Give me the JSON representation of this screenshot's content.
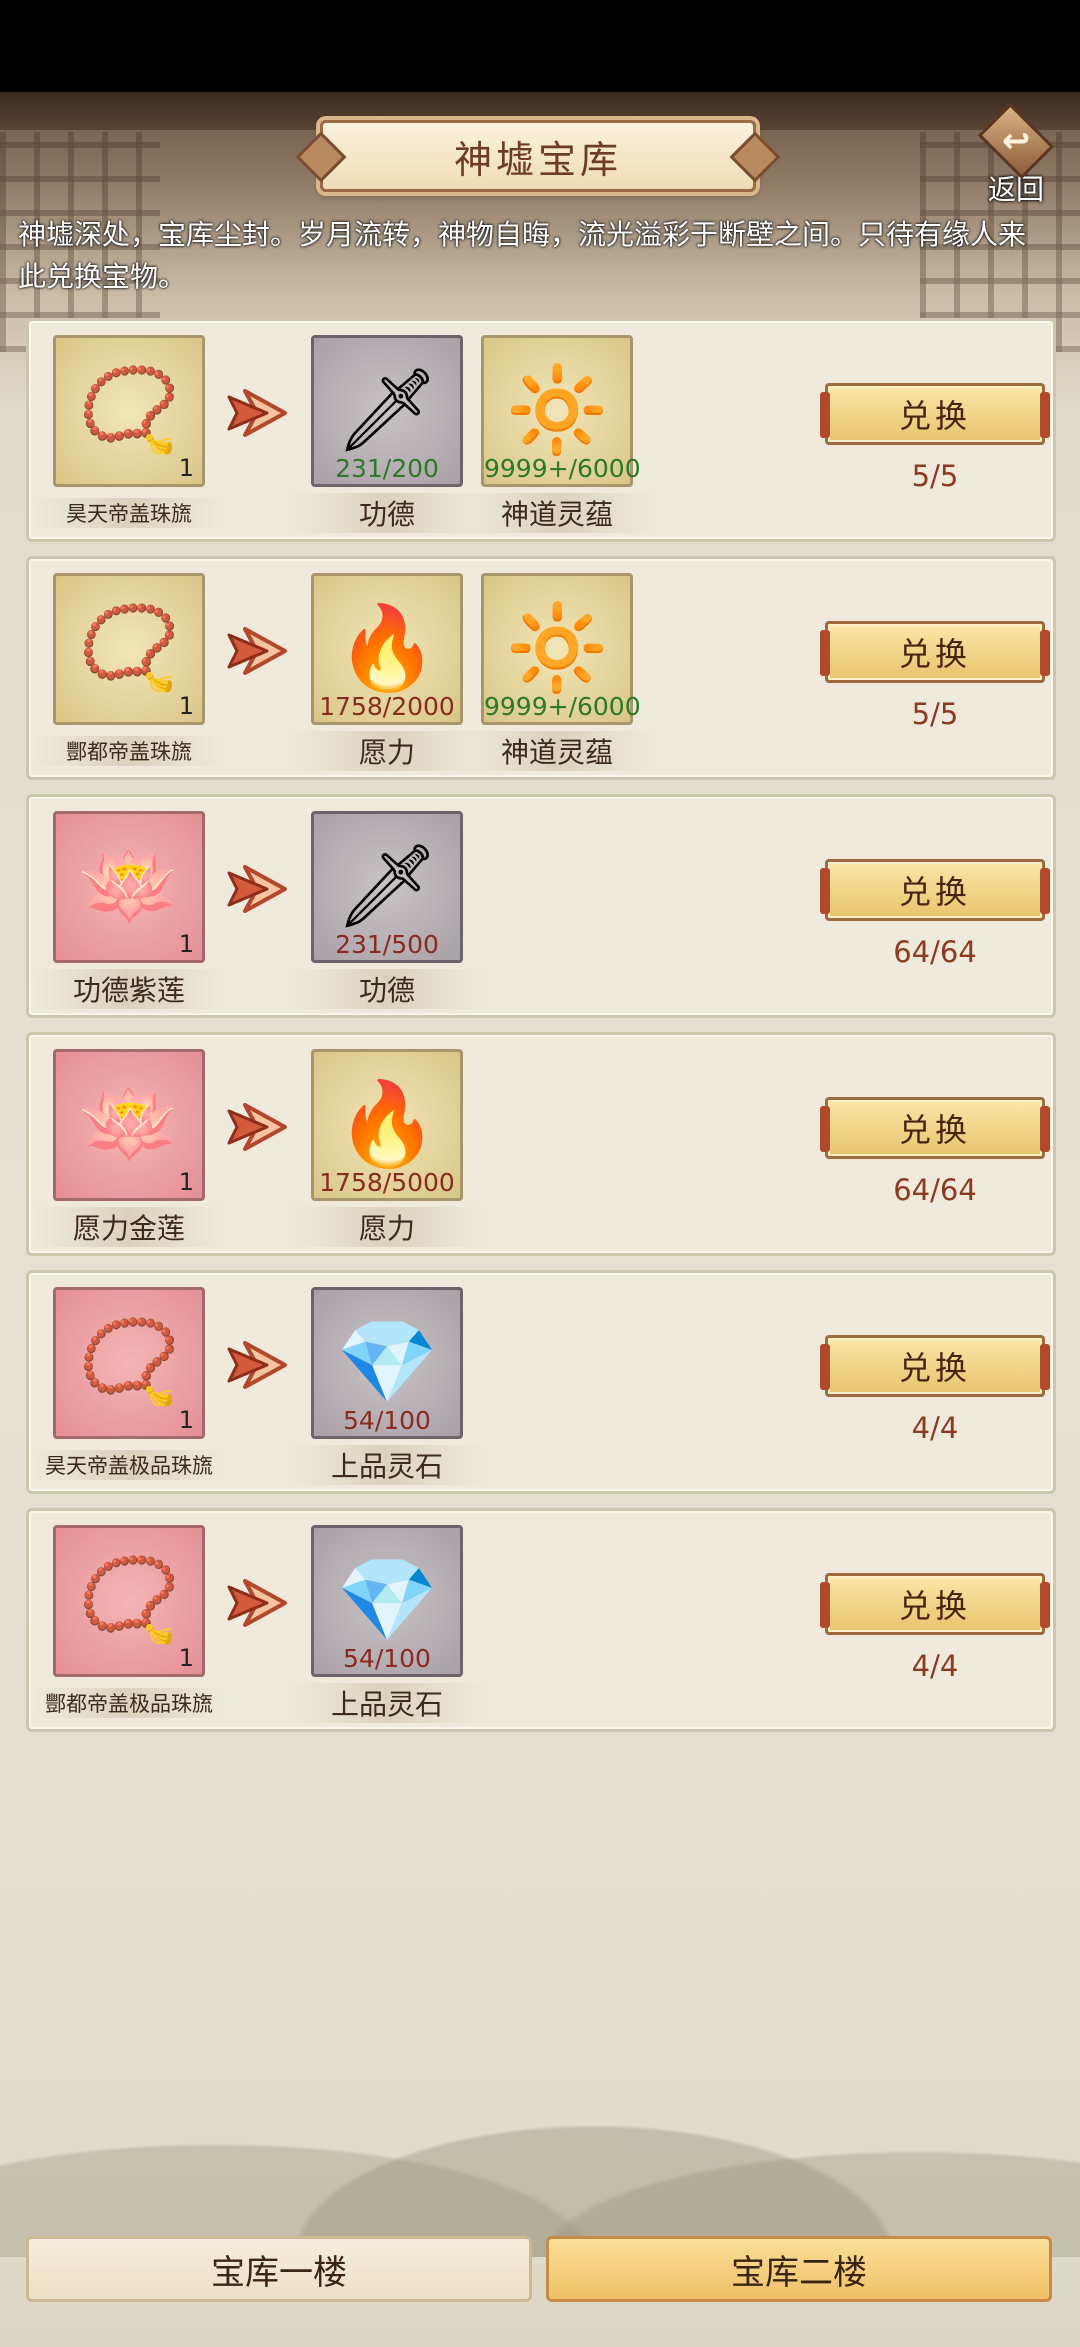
{
  "header": {
    "title": "神墟宝库",
    "back_label": "返回",
    "intro": "神墟深处，宝库尘封。岁月流转，神物自晦，流光溢彩于断壁之间。只待有缘人来此兑换宝物。"
  },
  "rows": [
    {
      "target": {
        "name": "昊天帝盖珠旒",
        "qty": "1",
        "frame": "gold",
        "icon": "pearl-necklace-icon",
        "glyph": "📿",
        "small": true
      },
      "costs": [
        {
          "name": "功德",
          "count": "231/200",
          "sufficient": true,
          "frame": "gray",
          "icon": "jade-sword-icon",
          "glyph": "🗡"
        },
        {
          "name": "神道灵蕴",
          "count": "9999+/6000",
          "sufficient": true,
          "frame": "gold",
          "icon": "golden-orb-icon",
          "glyph": "🔆"
        }
      ],
      "button": "兑换",
      "limit": "5/5"
    },
    {
      "target": {
        "name": "酆都帝盖珠旒",
        "qty": "1",
        "frame": "gold",
        "icon": "turquoise-necklace-icon",
        "glyph": "📿",
        "small": true
      },
      "costs": [
        {
          "name": "愿力",
          "count": "1758/2000",
          "sufficient": false,
          "frame": "gold",
          "icon": "flame-altar-icon",
          "glyph": "🔥"
        },
        {
          "name": "神道灵蕴",
          "count": "9999+/6000",
          "sufficient": true,
          "frame": "gold",
          "icon": "golden-orb-icon",
          "glyph": "🔆"
        }
      ],
      "button": "兑换",
      "limit": "5/5"
    },
    {
      "target": {
        "name": "功德紫莲",
        "qty": "1",
        "frame": "red",
        "icon": "purple-lotus-icon",
        "glyph": "🪷",
        "small": false
      },
      "costs": [
        {
          "name": "功德",
          "count": "231/500",
          "sufficient": false,
          "frame": "gray",
          "icon": "jade-sword-icon",
          "glyph": "🗡"
        }
      ],
      "button": "兑换",
      "limit": "64/64"
    },
    {
      "target": {
        "name": "愿力金莲",
        "qty": "1",
        "frame": "red",
        "icon": "golden-lotus-icon",
        "glyph": "🪷",
        "small": false
      },
      "costs": [
        {
          "name": "愿力",
          "count": "1758/5000",
          "sufficient": false,
          "frame": "gold",
          "icon": "flame-altar-icon",
          "glyph": "🔥"
        }
      ],
      "button": "兑换",
      "limit": "64/64"
    },
    {
      "target": {
        "name": "昊天帝盖极品珠旒",
        "qty": "1",
        "frame": "red",
        "icon": "ruby-necklace-icon",
        "glyph": "📿",
        "small": true
      },
      "costs": [
        {
          "name": "上品灵石",
          "count": "54/100",
          "sufficient": false,
          "frame": "gray",
          "icon": "purple-spirit-stone-icon",
          "glyph": "💎"
        }
      ],
      "button": "兑换",
      "limit": "4/4"
    },
    {
      "target": {
        "name": "酆都帝盖极品珠旒",
        "qty": "1",
        "frame": "red",
        "icon": "sapphire-necklace-icon",
        "glyph": "📿",
        "small": true
      },
      "costs": [
        {
          "name": "上品灵石",
          "count": "54/100",
          "sufficient": false,
          "frame": "gray",
          "icon": "purple-spirit-stone-icon",
          "glyph": "💎"
        }
      ],
      "button": "兑换",
      "limit": "4/4"
    }
  ],
  "tabs": [
    {
      "label": "宝库一楼",
      "active": false
    },
    {
      "label": "宝库二楼",
      "active": true
    }
  ],
  "colors": {
    "count_ok": "#2c7a28",
    "count_insufficient": "#8b2a1e",
    "limit_text": "#8c3a22",
    "active_tab": "#f1c167"
  }
}
